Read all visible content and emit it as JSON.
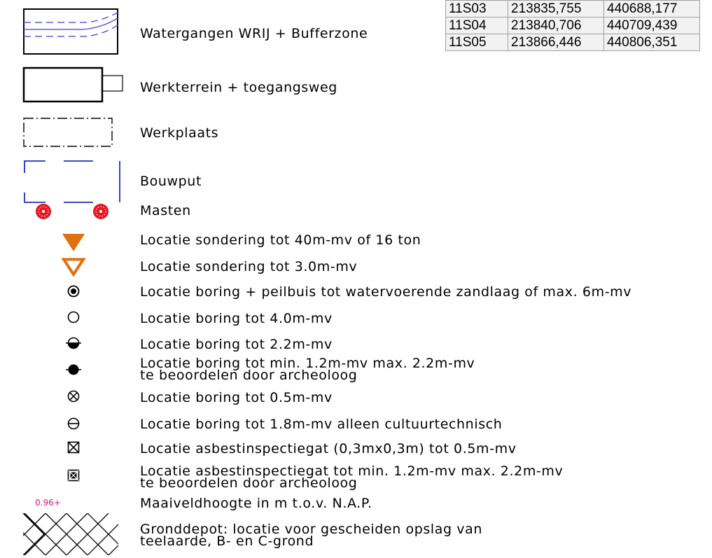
{
  "coordinates_table": [
    {
      "code": "11S03",
      "x": "213835,755",
      "y": "440688,177"
    },
    {
      "code": "11S04",
      "x": "213840,706",
      "y": "440709,439"
    },
    {
      "code": "11S05",
      "x": "213866,446",
      "y": "440806,351"
    }
  ],
  "legend": {
    "watergangen": "Watergangen WRIJ + Bufferzone",
    "werkterrein": "Werkterrein + toegangsweg",
    "werkplaats": "Werkplaats",
    "bouwput": "Bouwput",
    "masten": "Masten",
    "sondering_40m": "Locatie sondering tot 40m-mv of 16 ton",
    "sondering_3m": "Locatie sondering tot 3.0m-mv",
    "boring_peilbuis": "Locatie boring + peilbuis tot watervoerende zandlaag of max. 6m-mv",
    "boring_4m": "Locatie boring tot 4.0m-mv",
    "boring_2_2m": "Locatie boring tot 2.2m-mv",
    "boring_min_line1": "Locatie boring tot min. 1.2m-mv max. 2.2m-mv",
    "boring_min_line2": "te beoordelen door archeoloog",
    "boring_0_5m": "Locatie boring tot 0.5m-mv",
    "boring_1_8m": "Locatie boring tot 1.8m-mv alleen cultuurtechnisch",
    "asbest_0_5m": "Locatie asbestinspectiegat (0,3mx0,3m) tot 0.5m-mv",
    "asbest_min_line1": "Locatie asbestinspectiegat tot min. 1.2m-mv max. 2.2m-mv",
    "asbest_min_line2": "te beoordelen door archeoloog",
    "maaiveld": "Maaiveldhoogte in m t.o.v. N.A.P.",
    "gronddepot_line1": "Gronddepot: locatie voor gescheiden opslag van",
    "gronddepot_line2": "teelaarde, B- en C-grond"
  },
  "height_sample": "0.96+",
  "colors": {
    "water_line": "#5a5ae0",
    "bouwput_line": "#1f2fbf",
    "mast_red": "#e8141e",
    "sondering_orange": "#e07010",
    "height_magenta": "#e8178a",
    "table_bg": "#f2f2f2",
    "table_border": "#a0a0a0"
  }
}
